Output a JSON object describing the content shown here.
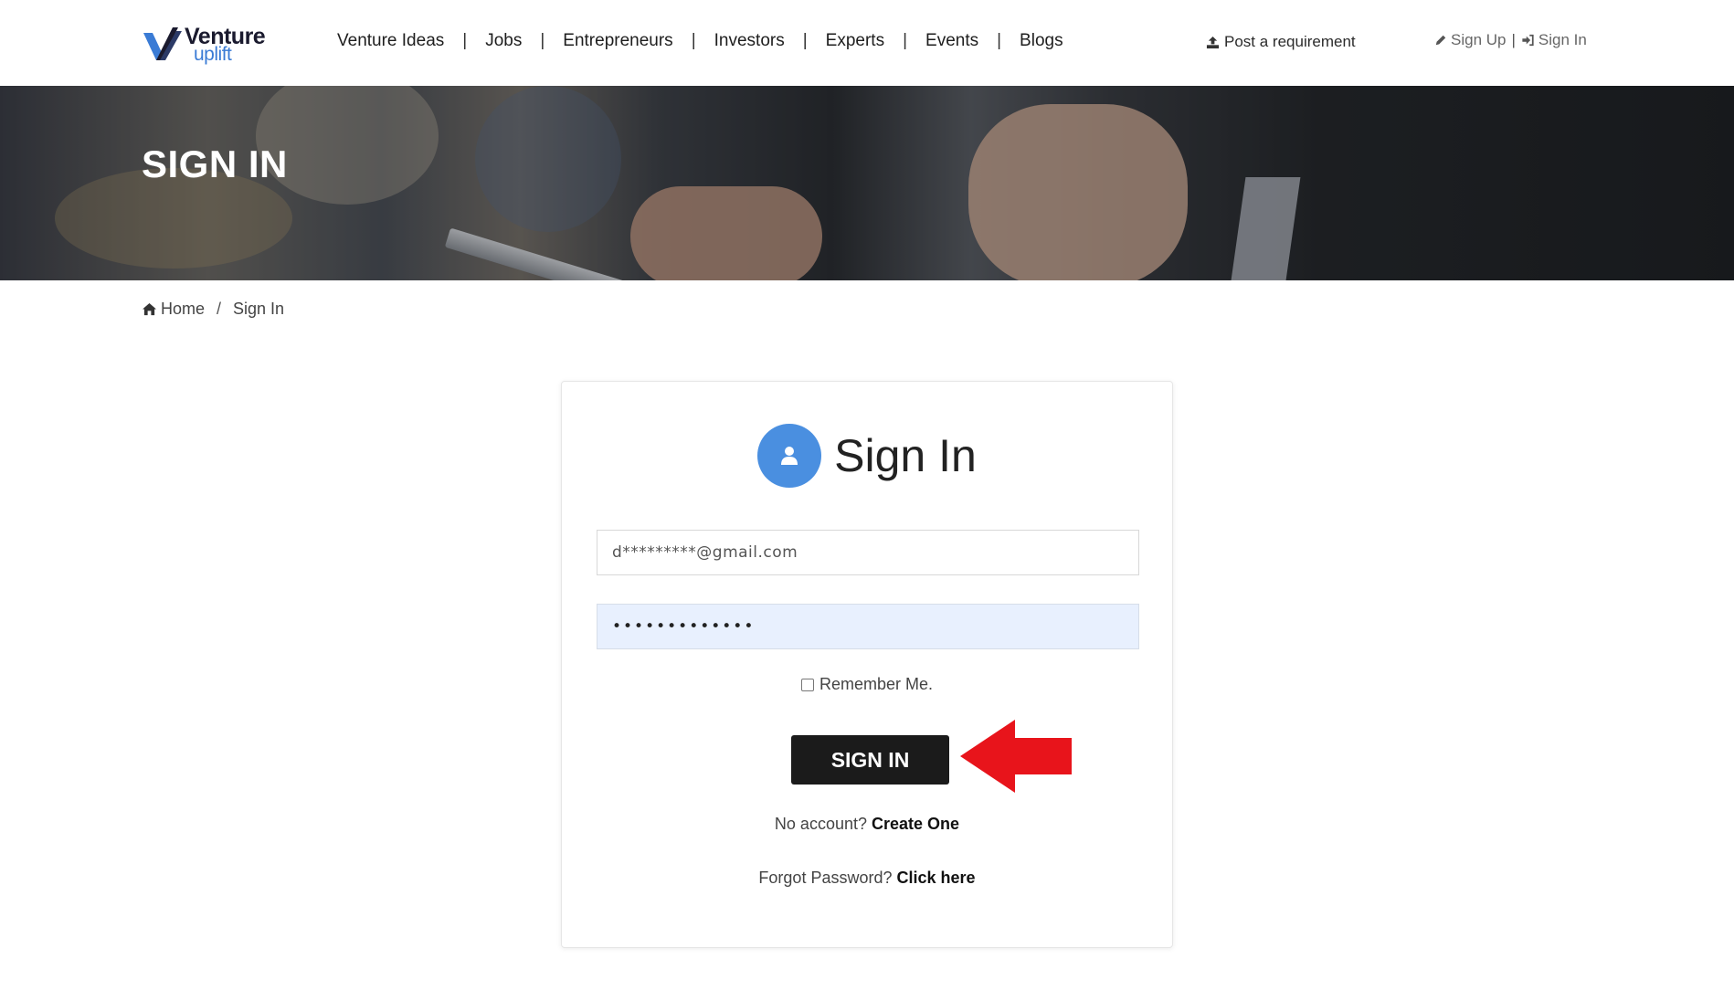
{
  "brand": {
    "logo_word": "Venture",
    "logo_sub": "uplift",
    "accent_color": "#3a7bd5",
    "icon": "venture-uplift-logo-icon"
  },
  "nav": {
    "items": [
      "Venture Ideas",
      "Jobs",
      "Entrepreneurs",
      "Investors",
      "Experts",
      "Events",
      "Blogs"
    ],
    "separator": "|"
  },
  "header_actions": {
    "post_requirement": "Post a requirement",
    "post_requirement_icon": "upload-icon",
    "sign_up": "Sign Up",
    "sign_up_icon": "pencil-icon",
    "divider": "|",
    "sign_in": "Sign In",
    "sign_in_icon": "sign-in-icon"
  },
  "banner": {
    "title": "SIGN IN"
  },
  "breadcrumb": {
    "home": "Home",
    "home_icon": "home-icon",
    "separator": "/",
    "current": "Sign In"
  },
  "form": {
    "title": "Sign In",
    "title_icon": "user-icon",
    "title_icon_color": "#4a8fe0",
    "email_value": "d*********@gmail.com",
    "password_value": "•••••••••••••",
    "remember_label": "Remember Me.",
    "remember_checked": false,
    "submit_label": "SIGN IN",
    "submit_color": "#1b1b1b",
    "annotation_arrow_color": "#e8141b",
    "no_account_text": "No account?",
    "create_link": "Create One",
    "forgot_text": "Forgot Password?",
    "forgot_link": "Click here"
  }
}
